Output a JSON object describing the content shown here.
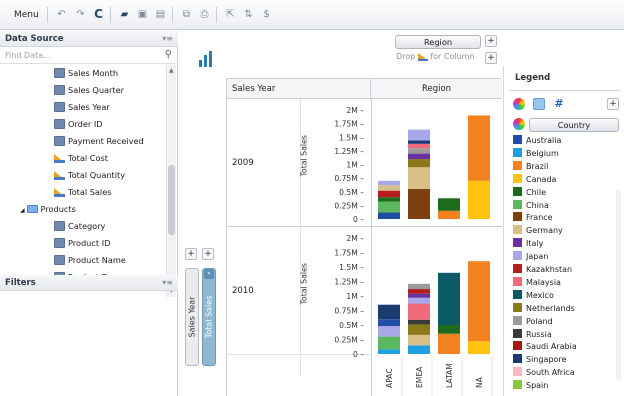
{
  "toolbar": {
    "menu_label": "Menu",
    "icons": [
      "undo-icon",
      "redo-icon",
      "refresh-icon",
      "open-folder-icon",
      "save-icon",
      "save-as-icon",
      "copy-icon",
      "print-icon",
      "export-icon",
      "sort-icon",
      "currency-icon"
    ]
  },
  "data_source": {
    "title": "Data Source",
    "pin": "▾≡",
    "search_placeholder": "Find Data...",
    "items": [
      {
        "label": "Sales Month",
        "icon": "calendar"
      },
      {
        "label": "Sales Quarter",
        "icon": "calendar"
      },
      {
        "label": "Sales Year",
        "icon": "calendar"
      },
      {
        "label": "Order ID",
        "icon": "calendar"
      },
      {
        "label": "Payment Received",
        "icon": "calendar"
      },
      {
        "label": "Total Cost",
        "icon": "measure"
      },
      {
        "label": "Total Quantity",
        "icon": "measure"
      },
      {
        "label": "Total Sales",
        "icon": "measure"
      },
      {
        "label": "Products",
        "icon": "folder"
      },
      {
        "label": "Category",
        "icon": "calendar"
      },
      {
        "label": "Product ID",
        "icon": "calendar"
      },
      {
        "label": "Product Name",
        "icon": "calendar"
      },
      {
        "label": "Product Type",
        "icon": "calendar"
      }
    ]
  },
  "filters": {
    "title": "Filters",
    "pin": "▾≡"
  },
  "pivot": {
    "column_field": "Region",
    "drop_hint_prefix": "Drop",
    "drop_hint_suffix": "for Column",
    "row_shelf_1": "Sales Year",
    "row_shelf_2": "Total Sales",
    "row_header": "Sales Year",
    "col_header": "Region",
    "years": [
      "2009",
      "2010"
    ],
    "measure_label": "Total Sales",
    "y_ticks": [
      "2M",
      "1.75M",
      "1.5M",
      "1.25M",
      "1M",
      "0.75M",
      "0.5M",
      "0.25M",
      "0"
    ]
  },
  "legend": {
    "title": "Legend",
    "field": "Country",
    "items": [
      {
        "label": "Australia",
        "color": "#1f4fa3"
      },
      {
        "label": "Belgium",
        "color": "#1fa0e0"
      },
      {
        "label": "Brazil",
        "color": "#f58220"
      },
      {
        "label": "Canada",
        "color": "#ffc20e"
      },
      {
        "label": "Chile",
        "color": "#1e6b1e"
      },
      {
        "label": "China",
        "color": "#5cb85c"
      },
      {
        "label": "France",
        "color": "#7b3f10"
      },
      {
        "label": "Germany",
        "color": "#d8c08a"
      },
      {
        "label": "Italy",
        "color": "#6a2fa0"
      },
      {
        "label": "Japan",
        "color": "#a8a8e8"
      },
      {
        "label": "Kazakhstan",
        "color": "#b41e1e"
      },
      {
        "label": "Malaysia",
        "color": "#f06a7a"
      },
      {
        "label": "Mexico",
        "color": "#0b5a66"
      },
      {
        "label": "Netherlands",
        "color": "#8a7a1a"
      },
      {
        "label": "Poland",
        "color": "#9a9a9a"
      },
      {
        "label": "Russia",
        "color": "#3a3a3a"
      },
      {
        "label": "Saudi Arabia",
        "color": "#a01818"
      },
      {
        "label": "Singapore",
        "color": "#1a3a70"
      },
      {
        "label": "South Africa",
        "color": "#f7b6c2"
      },
      {
        "label": "Spain",
        "color": "#8cc63f"
      }
    ]
  },
  "chart_data": {
    "type": "bar",
    "categories": [
      "APAC",
      "EMEA",
      "LATAM",
      "NA"
    ],
    "rows": [
      "2009",
      "2010"
    ],
    "ylim": [
      0,
      2000000
    ],
    "ylabel": "Total Sales",
    "stacks": {
      "2009": {
        "APAC": [
          [
            "Australia",
            120000
          ],
          [
            "China",
            200000
          ],
          [
            "Chile",
            80000
          ],
          [
            "Kazakhstan",
            120000
          ],
          [
            "Germany",
            100000
          ],
          [
            "Japan",
            80000
          ]
        ],
        "EMEA": [
          [
            "France",
            550000
          ],
          [
            "Germany",
            400000
          ],
          [
            "Netherlands",
            150000
          ],
          [
            "Italy",
            100000
          ],
          [
            "Poland",
            100000
          ],
          [
            "Malaysia",
            80000
          ],
          [
            "Singapore",
            60000
          ],
          [
            "Japan",
            200000
          ]
        ],
        "LATAM": [
          [
            "Brazil",
            150000
          ],
          [
            "Chile",
            230000
          ]
        ],
        "NA": [
          [
            "Canada",
            700000
          ],
          [
            "Brazil",
            1200000
          ]
        ]
      },
      "2010": {
        "APAC": [
          [
            "Belgium",
            80000
          ],
          [
            "China",
            220000
          ],
          [
            "Japan",
            180000
          ],
          [
            "Australia",
            120000
          ],
          [
            "Singapore",
            250000
          ]
        ],
        "EMEA": [
          [
            "Belgium",
            150000
          ],
          [
            "Germany",
            180000
          ],
          [
            "Netherlands",
            180000
          ],
          [
            "Russia",
            80000
          ],
          [
            "Malaysia",
            280000
          ],
          [
            "Japan",
            100000
          ],
          [
            "Italy",
            70000
          ],
          [
            "Kazakhstan",
            80000
          ],
          [
            "Poland",
            90000
          ]
        ],
        "LATAM": [
          [
            "Brazil",
            350000
          ],
          [
            "Chile",
            150000
          ],
          [
            "Mexico",
            900000
          ]
        ],
        "NA": [
          [
            "Canada",
            220000
          ],
          [
            "Brazil",
            1380000
          ]
        ]
      }
    }
  }
}
